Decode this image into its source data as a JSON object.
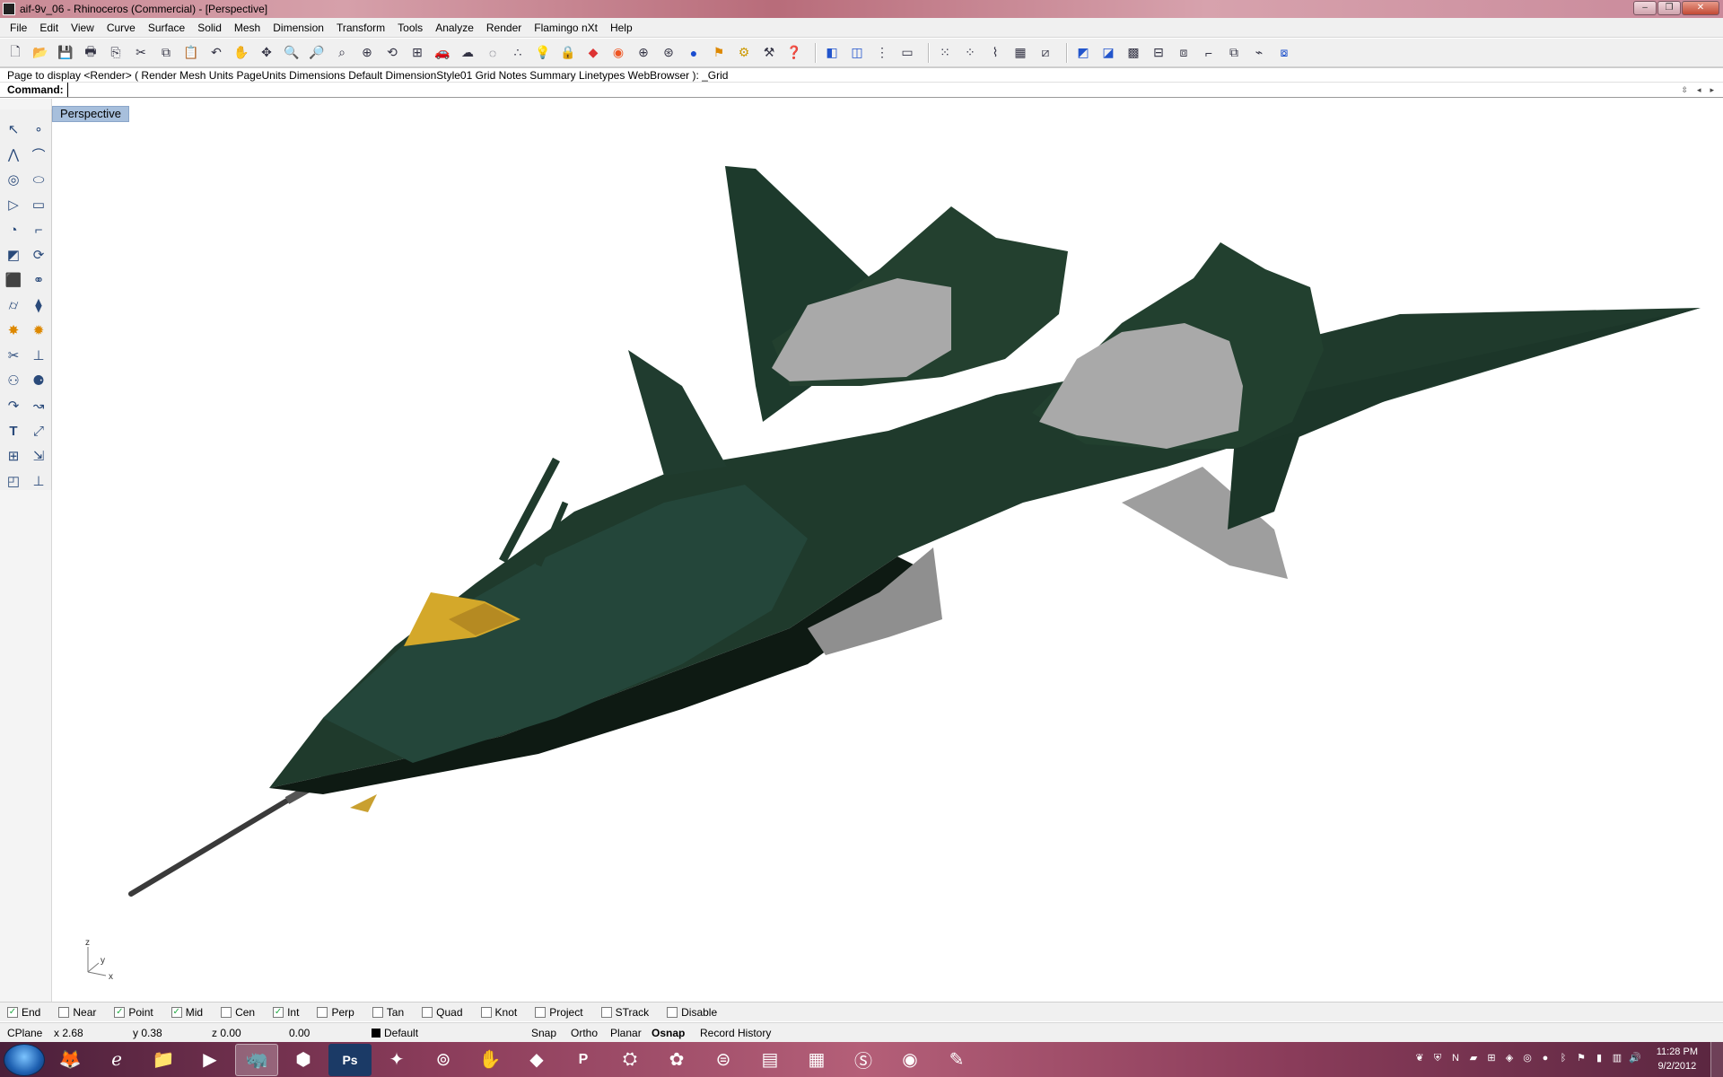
{
  "window": {
    "title": "aif-9v_06 - Rhinoceros (Commercial) - [Perspective]",
    "minimize": "–",
    "maximize": "❐",
    "close": "✕"
  },
  "menu": [
    "File",
    "Edit",
    "View",
    "Curve",
    "Surface",
    "Solid",
    "Mesh",
    "Dimension",
    "Transform",
    "Tools",
    "Analyze",
    "Render",
    "Flamingo nXt",
    "Help"
  ],
  "toolbar_icons": [
    "new-file-icon",
    "open-file-icon",
    "save-icon",
    "print-icon",
    "import-icon",
    "cut-icon",
    "copy-icon",
    "paste-icon",
    "undo-icon",
    "pan-icon",
    "rotate-view-icon",
    "zoom-icon",
    "zoom-window-icon",
    "zoom-extents-icon",
    "zoom-selected-icon",
    "undo-view-icon",
    "four-viewports-icon",
    "car-icon",
    "hide-icon",
    "show-icon",
    "point-icon",
    "lightbulb-icon",
    "lock-icon",
    "layer-icon",
    "color-wheel-icon",
    "sphere-wire-icon",
    "sphere-mesh-icon",
    "sphere-render-icon",
    "flag-icon",
    "gear-icon",
    "options-icon",
    "help-icon"
  ],
  "command": {
    "history": "Page to display <Render> ( Render  Mesh  Units  PageUnits  Dimensions  Default  DimensionStyle01  Grid  Notes  Summary  Linetypes  WebBrowser ): _Grid",
    "label": "Command:",
    "value": ""
  },
  "viewport": {
    "tab": "Perspective",
    "axis_labels": {
      "z": "z",
      "y": "y",
      "x": "x"
    }
  },
  "left_tools": [
    "select-arrow-icon",
    "point-icon",
    "polyline-icon",
    "curve-icon",
    "circle-icon",
    "ellipse-icon",
    "polygon-icon",
    "rectangle-icon",
    "arc-icon",
    "fillet-icon",
    "surface-icon",
    "sweep-icon",
    "box-icon",
    "boolean-icon",
    "cylinder-icon",
    "extrude-icon",
    "mesh-icon",
    "explode-icon",
    "trim-icon",
    "split-icon",
    "join-icon",
    "group-icon",
    "offset-icon",
    "curve-blend-icon",
    "text-icon",
    "scale-icon",
    "array-icon",
    "transform-icon",
    "solid-box-icon",
    "dimension-icon"
  ],
  "osnap": [
    {
      "label": "End",
      "checked": true
    },
    {
      "label": "Near",
      "checked": false
    },
    {
      "label": "Point",
      "checked": true
    },
    {
      "label": "Mid",
      "checked": true
    },
    {
      "label": "Cen",
      "checked": false
    },
    {
      "label": "Int",
      "checked": true
    },
    {
      "label": "Perp",
      "checked": false
    },
    {
      "label": "Tan",
      "checked": false
    },
    {
      "label": "Quad",
      "checked": false
    },
    {
      "label": "Knot",
      "checked": false
    },
    {
      "label": "Project",
      "checked": false
    },
    {
      "label": "STrack",
      "checked": false
    },
    {
      "label": "Disable",
      "checked": false
    }
  ],
  "status": {
    "cplane": "CPlane",
    "x": "x 2.68",
    "y": "y 0.38",
    "z": "z 0.00",
    "distance": "0.00",
    "layer": "Default",
    "snap": "Snap",
    "ortho": "Ortho",
    "planar": "Planar",
    "osnap": "Osnap",
    "record_history": "Record History"
  },
  "taskbar": {
    "apps": [
      "firefox-icon",
      "internet-explorer-icon",
      "folder-icon",
      "media-player-icon",
      "rhino-icon",
      "sketchup-icon",
      "photoshop-icon",
      "zbrush-icon",
      "steam-icon",
      "gesture-icon",
      "app-red-icon",
      "powerpoint-icon",
      "app-blue-icon",
      "app-green-icon",
      "dreamweaver-icon",
      "notepad-icon",
      "calculator-icon",
      "skype-icon",
      "eye-icon",
      "paint-icon"
    ],
    "active_app": "rhino-icon",
    "time": "11:28 PM",
    "date": "9/2/2012"
  },
  "colors": {
    "aircraft_green": "#1f3a2c",
    "aircraft_gray": "#a9a9a9",
    "canopy_gold": "#d4a82a",
    "viewport_tab": "#a7bfdc"
  }
}
